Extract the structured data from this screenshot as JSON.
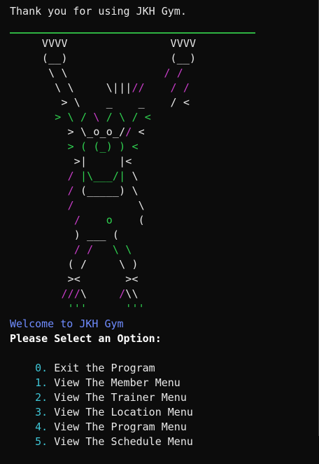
{
  "thanks": "Thank you for using JKH Gym.",
  "colors": {
    "white": "#e8e8e8",
    "purple": "#c83dc8",
    "green": "#2fcf4f",
    "welcome_blue": "#6f8cff",
    "number_cyan": "#3ec6d6",
    "rule_green": "#2fb343",
    "background": "#0c0c0c"
  },
  "art_lines": [
    [
      {
        "t": "     VVVV                VVVV",
        "c": "w"
      }
    ],
    [
      {
        "t": "     (__)                (__)",
        "c": "w"
      }
    ],
    [
      {
        "t": "      \\ \\               ",
        "c": "w"
      },
      {
        "t": "/ /",
        "c": "p"
      }
    ],
    [
      {
        "t": "       \\ \\     \\|||",
        "c": "w"
      },
      {
        "t": "//",
        "c": "p"
      },
      {
        "t": "    ",
        "c": "w"
      },
      {
        "t": "/ /",
        "c": "p"
      }
    ],
    [
      {
        "t": "        > \\    _    _    / <",
        "c": "w"
      }
    ],
    [
      {
        "t": "       ",
        "c": "w"
      },
      {
        "t": "> \\ /",
        "c": "g"
      },
      {
        "t": " \\ ",
        "c": "p"
      },
      {
        "t": "/ \\ / <",
        "c": "g"
      }
    ],
    [
      {
        "t": "         > \\_o_o_/",
        "c": "w"
      },
      {
        "t": "/",
        "c": "p"
      },
      {
        "t": " <",
        "c": "w"
      }
    ],
    [
      {
        "t": "         ",
        "c": "w"
      },
      {
        "t": "> ( (_) ) <",
        "c": "g"
      }
    ],
    [
      {
        "t": "          >|     |<",
        "c": "w"
      }
    ],
    [
      {
        "t": "         ",
        "c": "w"
      },
      {
        "t": "/ ",
        "c": "p"
      },
      {
        "t": "|\\___/|",
        "c": "g"
      },
      {
        "t": " \\",
        "c": "w"
      }
    ],
    [
      {
        "t": "         ",
        "c": "w"
      },
      {
        "t": "/ ",
        "c": "p"
      },
      {
        "t": "(_____)",
        "c": "w"
      },
      {
        "t": " \\",
        "c": "w"
      }
    ],
    [
      {
        "t": "         ",
        "c": "w"
      },
      {
        "t": "/",
        "c": "p"
      },
      {
        "t": "          \\",
        "c": "w"
      }
    ],
    [
      {
        "t": "          ",
        "c": "w"
      },
      {
        "t": "/",
        "c": "p"
      },
      {
        "t": "    ",
        "c": "w"
      },
      {
        "t": "o",
        "c": "g"
      },
      {
        "t": "    (",
        "c": "w"
      }
    ],
    [
      {
        "t": "          ) ___ (",
        "c": "w"
      }
    ],
    [
      {
        "t": "          ",
        "c": "w"
      },
      {
        "t": "/ /",
        "c": "p"
      },
      {
        "t": "   ",
        "c": "w"
      },
      {
        "t": "\\ \\",
        "c": "g"
      }
    ],
    [
      {
        "t": "         ( /     \\ )",
        "c": "w"
      }
    ],
    [
      {
        "t": "         ><       ><",
        "c": "w"
      }
    ],
    [
      {
        "t": "        ",
        "c": "w"
      },
      {
        "t": "///",
        "c": "p"
      },
      {
        "t": "\\     ",
        "c": "w"
      },
      {
        "t": "/",
        "c": "p"
      },
      {
        "t": "\\\\",
        "c": "w"
      }
    ],
    [
      {
        "t": "         ",
        "c": "w"
      },
      {
        "t": "'''",
        "c": "g"
      },
      {
        "t": "      ",
        "c": "w"
      },
      {
        "t": "'''",
        "c": "g"
      }
    ]
  ],
  "welcome": "Welcome to JKH Gym",
  "prompt": "Please Select an Option:",
  "options": [
    {
      "num": "0.",
      "label": " Exit the Program"
    },
    {
      "num": "1.",
      "label": " View The Member Menu"
    },
    {
      "num": "2.",
      "label": " View The Trainer Menu"
    },
    {
      "num": "3.",
      "label": " View The Location Menu"
    },
    {
      "num": "4.",
      "label": " View The Program Menu"
    },
    {
      "num": "5.",
      "label": " View The Schedule Menu"
    }
  ]
}
